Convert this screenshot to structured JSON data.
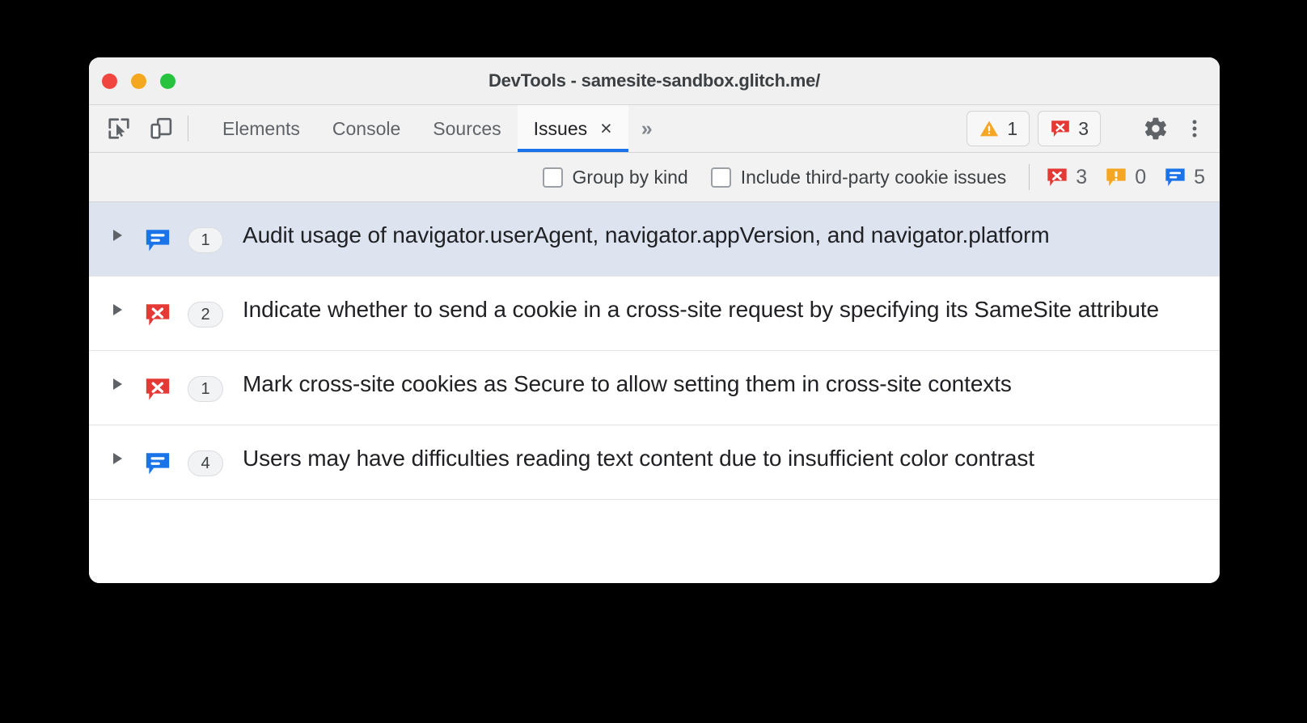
{
  "window": {
    "title": "DevTools - samesite-sandbox.glitch.me/",
    "traffic_lights": {
      "close": "close-button",
      "minimize": "minimize-button",
      "maximize": "maximize-button"
    },
    "colors": {
      "close": "#f0463f",
      "minimize": "#f4a81d",
      "maximize": "#27c33f",
      "accent": "#1a73e8",
      "selected_row": "#dde4ef",
      "error": "#e53935",
      "warning": "#f5a623",
      "info": "#1a73e8"
    }
  },
  "toolbar": {
    "inspect_icon": "inspect-element-icon",
    "device_icon": "device-toolbar-icon",
    "tabs": [
      {
        "label": "Elements",
        "active": false
      },
      {
        "label": "Console",
        "active": false
      },
      {
        "label": "Sources",
        "active": false
      },
      {
        "label": "Issues",
        "active": true
      }
    ],
    "close_tab_label": "×",
    "overflow_label": "»",
    "warning_count": "1",
    "error_count": "3",
    "settings_icon": "gear-icon",
    "more_icon": "kebab-menu-icon"
  },
  "filterbar": {
    "group_by_kind": {
      "label": "Group by kind",
      "checked": false
    },
    "include_third_party": {
      "label": "Include third-party cookie issues",
      "checked": false
    },
    "counts": {
      "errors": "3",
      "warnings": "0",
      "info": "5"
    }
  },
  "issues": [
    {
      "kind": "info",
      "count": "1",
      "text": "Audit usage of navigator.userAgent, navigator.appVersion, and navigator.platform",
      "selected": true
    },
    {
      "kind": "error",
      "count": "2",
      "text": "Indicate whether to send a cookie in a cross-site request by specifying its SameSite attribute",
      "selected": false
    },
    {
      "kind": "error",
      "count": "1",
      "text": "Mark cross-site cookies as Secure to allow setting them in cross-site contexts",
      "selected": false
    },
    {
      "kind": "info",
      "count": "4",
      "text": "Users may have difficulties reading text content due to insufficient color contrast",
      "selected": false
    }
  ]
}
